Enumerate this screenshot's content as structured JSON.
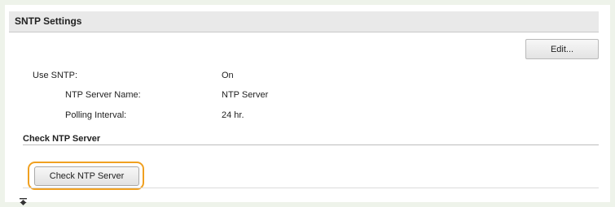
{
  "section": {
    "title": "SNTP Settings",
    "edit_label": "Edit..."
  },
  "settings": [
    {
      "label": "Use SNTP:",
      "value": "On"
    },
    {
      "label": "NTP Server Name:",
      "value": "NTP Server"
    },
    {
      "label": "Polling Interval:",
      "value": "24 hr."
    }
  ],
  "check": {
    "title": "Check NTP Server",
    "button_label": "Check NTP Server"
  },
  "footer": {
    "icon": "scroll-to-top-icon"
  },
  "colors": {
    "background": "#eef3ea",
    "header": "#e9e9e9",
    "highlight": "#f0a020"
  }
}
